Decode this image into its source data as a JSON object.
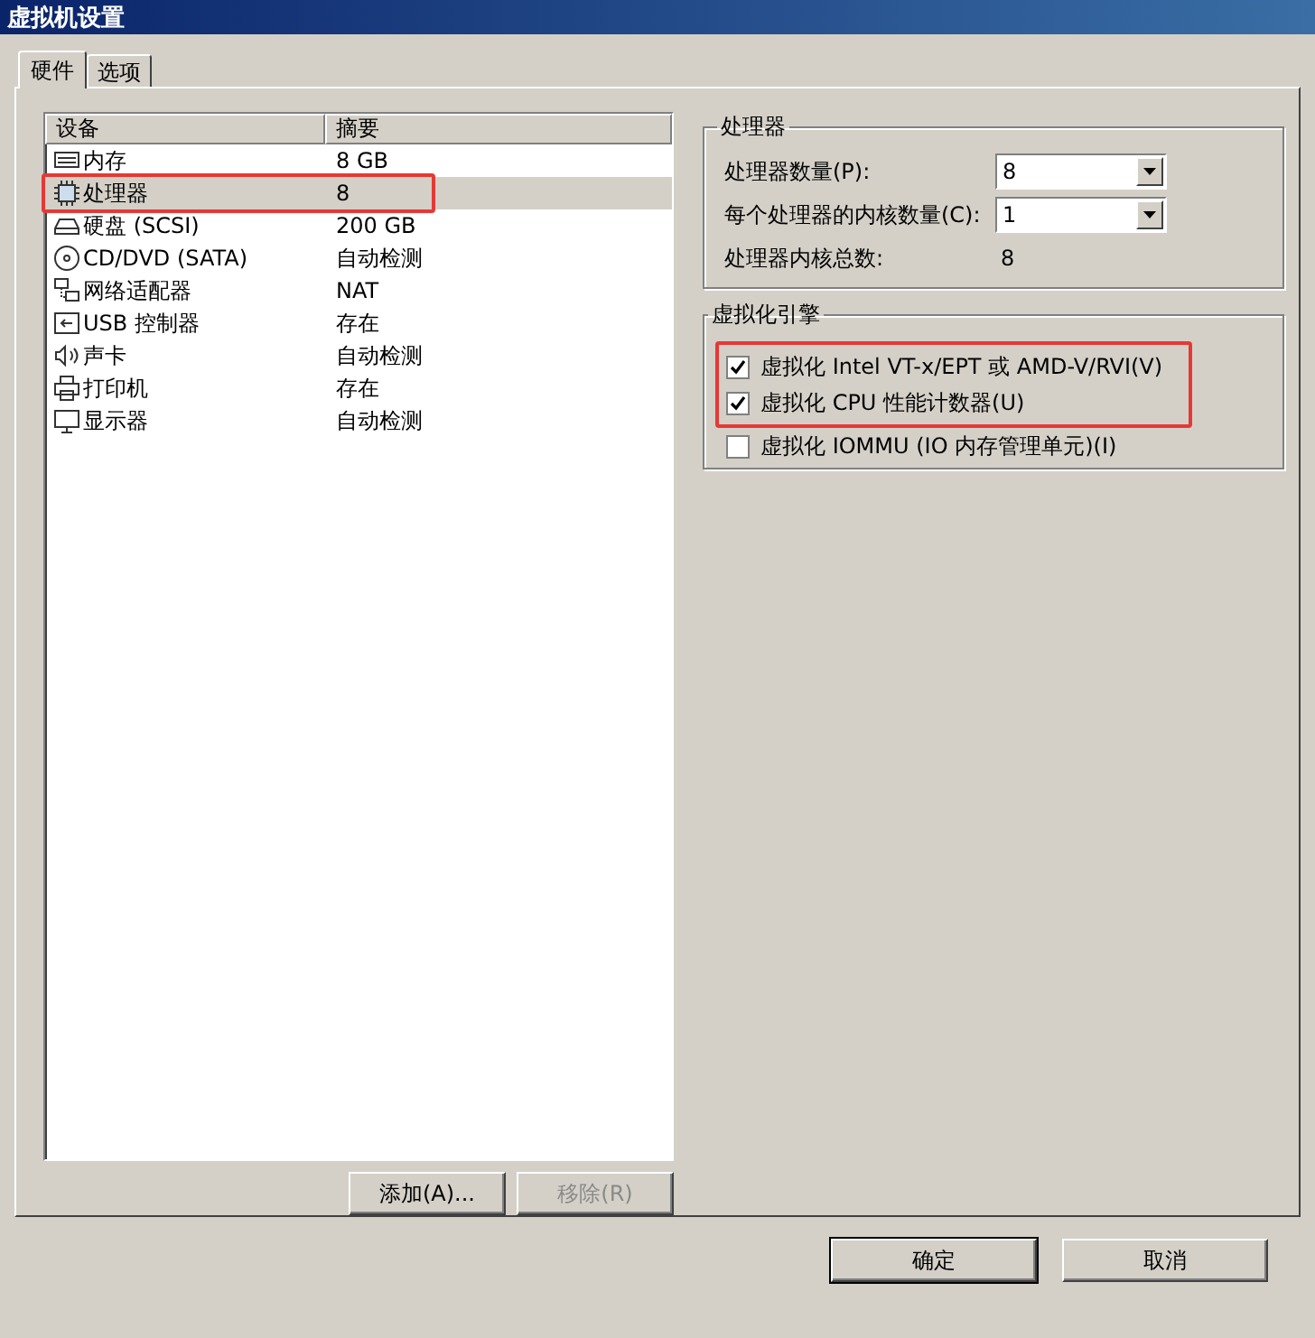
{
  "window": {
    "title": "虚拟机设置"
  },
  "tabs": [
    {
      "label": "硬件",
      "selected": true
    },
    {
      "label": "选项",
      "selected": false
    }
  ],
  "device_list": {
    "columns": [
      "设备",
      "摘要"
    ],
    "rows": [
      {
        "kind": "memory",
        "device": "内存",
        "summary": "8 GB",
        "selected": false,
        "highlighted": false
      },
      {
        "kind": "cpu",
        "device": "处理器",
        "summary": "8",
        "selected": true,
        "highlighted": true
      },
      {
        "kind": "disk",
        "device": "硬盘 (SCSI)",
        "summary": "200 GB",
        "selected": false,
        "highlighted": false
      },
      {
        "kind": "cd",
        "device": "CD/DVD (SATA)",
        "summary": "自动检测",
        "selected": false,
        "highlighted": false
      },
      {
        "kind": "network",
        "device": "网络适配器",
        "summary": "NAT",
        "selected": false,
        "highlighted": false
      },
      {
        "kind": "usb",
        "device": "USB 控制器",
        "summary": "存在",
        "selected": false,
        "highlighted": false
      },
      {
        "kind": "sound",
        "device": "声卡",
        "summary": "自动检测",
        "selected": false,
        "highlighted": false
      },
      {
        "kind": "printer",
        "device": "打印机",
        "summary": "存在",
        "selected": false,
        "highlighted": false
      },
      {
        "kind": "display",
        "device": "显示器",
        "summary": "自动检测",
        "selected": false,
        "highlighted": false
      }
    ],
    "buttons": [
      {
        "label": "添加(A)...",
        "disabled": false
      },
      {
        "label": "移除(R)",
        "disabled": true
      }
    ]
  },
  "processor": {
    "title": "处理器",
    "fields": [
      {
        "label": "处理器数量(P):",
        "value": "8"
      },
      {
        "label": "每个处理器的内核数量(C):",
        "value": "1"
      }
    ],
    "total_label": "处理器内核总数:",
    "total_value": "8"
  },
  "engine": {
    "title": "虚拟化引擎",
    "options": [
      {
        "label": "虚拟化 Intel VT-x/EPT 或 AMD-V/RVI(V)",
        "checked": true,
        "highlighted": true
      },
      {
        "label": "虚拟化 CPU 性能计数器(U)",
        "checked": true,
        "highlighted": true
      },
      {
        "label": "虚拟化 IOMMU (IO 内存管理单元)(I)",
        "checked": false,
        "highlighted": false
      }
    ]
  },
  "dialog_buttons": [
    {
      "label": "确定",
      "default": true
    },
    {
      "label": "取消",
      "default": false
    }
  ]
}
